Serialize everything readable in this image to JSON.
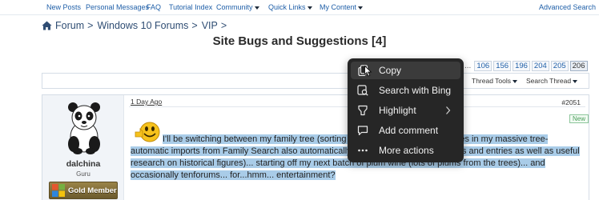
{
  "top_nav": {
    "items": [
      {
        "label": "New Posts"
      },
      {
        "label": "Personal Messages"
      },
      {
        "label": "FAQ"
      },
      {
        "label": "Tutorial Index"
      },
      {
        "label": "Community"
      },
      {
        "label": "Quick Links"
      },
      {
        "label": "My Content"
      }
    ],
    "advanced_search": "Advanced Search"
  },
  "breadcrumb": {
    "items": [
      "Forum",
      "Windows 10 Forums",
      "VIP"
    ],
    "separator": ">"
  },
  "page_title": "Site Bugs and Suggestions [4]",
  "pagination": {
    "ellipsis": "...",
    "pages": [
      "106",
      "156",
      "196",
      "204",
      "205",
      "206"
    ],
    "current": "206"
  },
  "toolbar": {
    "thread_tools": "Thread Tools",
    "search_thread": "Search Thread"
  },
  "post": {
    "date": "1 Day Ago",
    "number": "#2051",
    "new_badge": "New",
    "author": {
      "username": "dalchina",
      "title": "Guru",
      "badge": "Gold Member"
    },
    "body": "I'll be switching between my family tree (sorting out a few clusters of duplicates in my massive tree- automatic imports from Family Search also automatically introduce duplicated persons and entries as well as useful research on historical figures)... starting off my next batch of plum wine (lots of plums from the trees)... and occasionally tenforums... for...hmm... entertainment?",
    "highlight_color": "#a9cce8"
  },
  "context_menu": {
    "items": [
      {
        "label": "Copy",
        "icon": "copy-icon",
        "hovered": true
      },
      {
        "label": "Search with Bing",
        "icon": "search-with-bing-icon"
      },
      {
        "label": "Highlight",
        "icon": "highlight-icon",
        "submenu": true
      },
      {
        "label": "Add comment",
        "icon": "comment-icon"
      },
      {
        "label": "More actions",
        "icon": "more-actions-icon"
      }
    ],
    "background": "#262626",
    "hover_background": "#3b3b3b"
  },
  "colors": {
    "link": "#1f5fa8",
    "breadcrumb": "#2f4d73",
    "sidebar_bg": "#f1f4f8"
  }
}
